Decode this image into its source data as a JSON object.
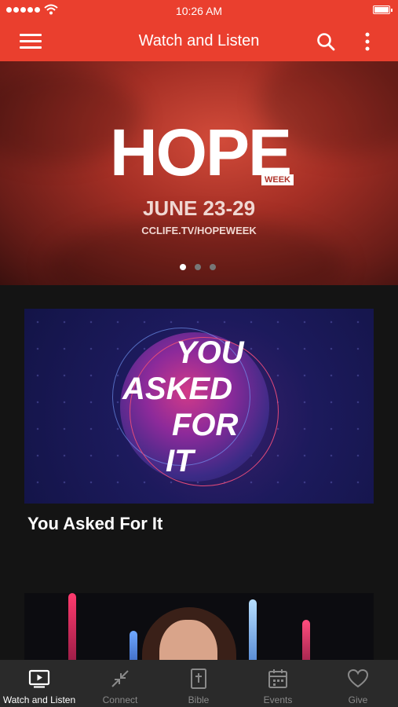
{
  "status_bar": {
    "time": "10:26 AM"
  },
  "app_bar": {
    "title": "Watch and Listen"
  },
  "hero": {
    "headline": "HOPE",
    "badge": "WEEK",
    "date": "JUNE 23-29",
    "url": "CCLIFE.TV/HOPEWEEK",
    "page_count": 3,
    "active_page": 1
  },
  "feed": {
    "card1": {
      "art_lines": [
        "YOU",
        "ASKED",
        "FOR",
        "IT"
      ],
      "title": "You Asked For It"
    }
  },
  "tabs": [
    {
      "label": "Watch and Listen",
      "icon": "play-screen-icon",
      "active": true
    },
    {
      "label": "Connect",
      "icon": "connect-arrows-icon",
      "active": false
    },
    {
      "label": "Bible",
      "icon": "bible-icon",
      "active": false
    },
    {
      "label": "Events",
      "icon": "calendar-icon",
      "active": false
    },
    {
      "label": "Give",
      "icon": "heart-icon",
      "active": false
    }
  ],
  "colors": {
    "accent": "#ea3f2e",
    "tabbar": "#2a2a2a",
    "background": "#141414"
  }
}
